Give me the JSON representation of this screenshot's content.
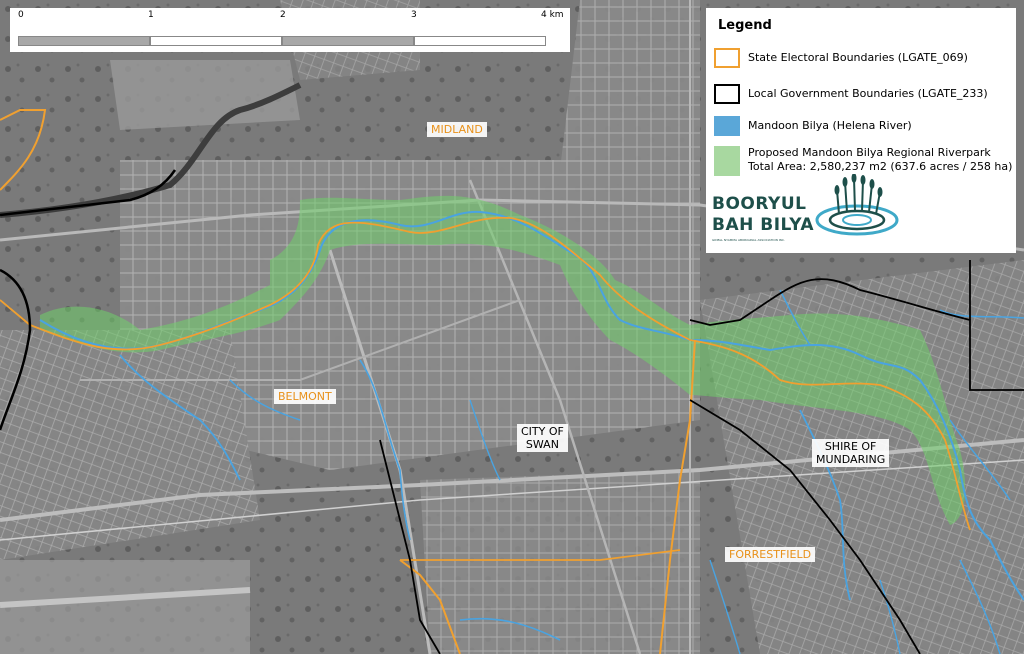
{
  "scale_bar": {
    "ticks": [
      "0",
      "1",
      "2",
      "3",
      "4 km"
    ]
  },
  "legend": {
    "title": "Legend",
    "items": [
      {
        "label": "State Electoral Boundaries (LGATE_069)",
        "style": "outline",
        "color": "#f0a030"
      },
      {
        "label": "Local Government Boundaries (LGATE_233)",
        "style": "outline",
        "color": "#000000"
      },
      {
        "label": "Mandoon Bilya (Helena River)",
        "style": "fill",
        "color": "#5aa7d8"
      },
      {
        "label": "Proposed Mandoon Bilya Regional Riverpark",
        "label2": "Total Area: 2,580,237 m2 (637.6 acres / 258 ha)",
        "style": "fill",
        "color": "#a8d8a0"
      }
    ]
  },
  "logo": {
    "line1": "BOORYUL",
    "line2": "BAH BILYA",
    "small_print": "GIDBLL NYAMMA ABORIGINAL ASSOCIATION INC."
  },
  "places": {
    "midland": "MIDLAND",
    "belmont": "BELMONT",
    "forrestfield": "FORRESTFIELD",
    "swan_line1": "CITY OF",
    "swan_line2": "SWAN",
    "mundaring_line1": "SHIRE OF",
    "mundaring_line2": "MUNDARING"
  },
  "colors": {
    "state_boundary": "#f0a030",
    "lga_boundary": "#000000",
    "river": "#4aa3e0",
    "riverpark": "#7fd07a",
    "logo": "#1e4f4a"
  }
}
